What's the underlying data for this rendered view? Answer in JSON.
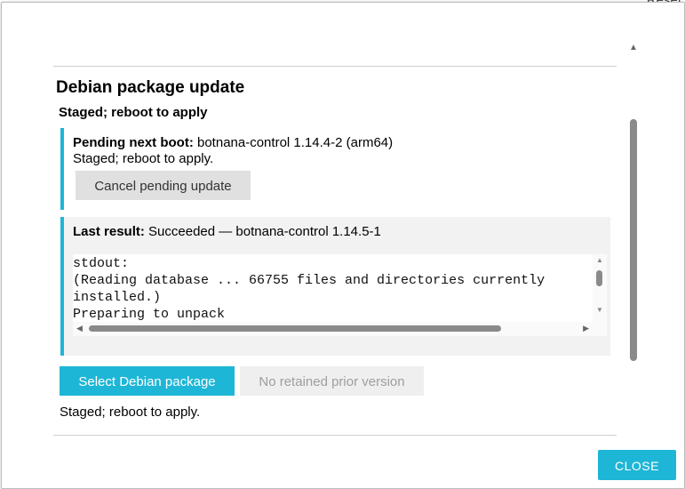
{
  "background": {
    "corner_text": "Reset"
  },
  "dialog": {
    "section_title": "Debian package update",
    "status_heading": "Staged; reboot to apply",
    "pending": {
      "label": "Pending next boot:",
      "value": "botnana-control 1.14.4-2 (arm64)",
      "note": "Staged; reboot to apply.",
      "cancel_label": "Cancel pending update"
    },
    "result": {
      "label": "Last result:",
      "value": "Succeeded — botnana-control 1.14.5-1",
      "log": "stdout:\n(Reading database ... 66755 files and directories currently\ninstalled.)\nPreparing to unpack"
    },
    "select_button_label": "Select Debian package",
    "no_prior_label": "No retained prior version",
    "footer_status": "Staged; reboot to apply.",
    "close_label": "CLOSE"
  },
  "colors": {
    "accent": "#1eb6d6",
    "disabled_text": "#9e9e9e"
  },
  "icons": {
    "dialog_scroll_up": "chevron-up-icon",
    "log_scroll_up": "chevron-up-icon",
    "log_scroll_down": "chevron-down-icon",
    "log_scroll_left": "chevron-left-icon",
    "log_scroll_right": "chevron-right-icon"
  }
}
